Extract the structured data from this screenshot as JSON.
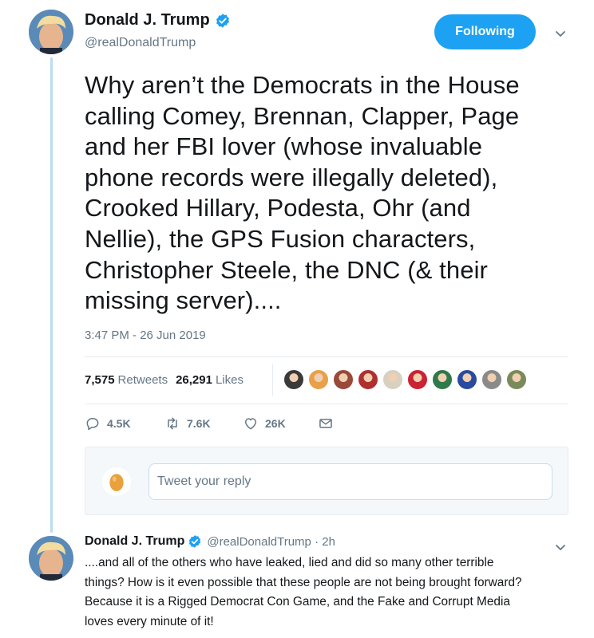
{
  "main_tweet": {
    "display_name": "Donald J. Trump",
    "handle": "@realDonaldTrump",
    "follow_label": "Following",
    "text_lines": [
      "Why aren’t the Democrats in the House",
      "calling Comey, Brennan, Clapper, Page",
      "and her FBI lover (whose invaluable",
      "phone records were illegally deleted),",
      "Crooked Hillary, Podesta, Ohr (and",
      "Nellie), the GPS Fusion characters,",
      "Christopher Steele, the DNC (& their",
      "missing server)...."
    ],
    "timestamp": "3:47 PM - 26 Jun 2019",
    "retweets_count": "7,575",
    "retweets_label": "Retweets",
    "likes_count": "26,291",
    "likes_label": "Likes",
    "liker_avatar_colors": [
      "#3a3a3a",
      "#e8a04a",
      "#9a4a3a",
      "#b03030",
      "#d8d0c0",
      "#cc2233",
      "#2e7a4a",
      "#2a4aa0",
      "#8a8a8a",
      "#7a8a5a"
    ],
    "actions": {
      "replies": "4.5K",
      "retweets": "7.6K",
      "likes": "26K"
    }
  },
  "reply_box": {
    "placeholder": "Tweet your reply"
  },
  "reply_tweet": {
    "display_name": "Donald J. Trump",
    "handle": "@realDonaldTrump · 2h",
    "text_lines": [
      "....and all of the others who have leaked, lied and did so many other terrible",
      "things? How is it even possible that these people are not being brought forward?",
      "Because it is a Rigged Democrat Con Game, and the Fake and Corrupt Media",
      "loves every minute of it!"
    ]
  },
  "colors": {
    "accent": "#1da1f2",
    "secondary_text": "#657786",
    "thread_line": "#bcdcf2"
  }
}
